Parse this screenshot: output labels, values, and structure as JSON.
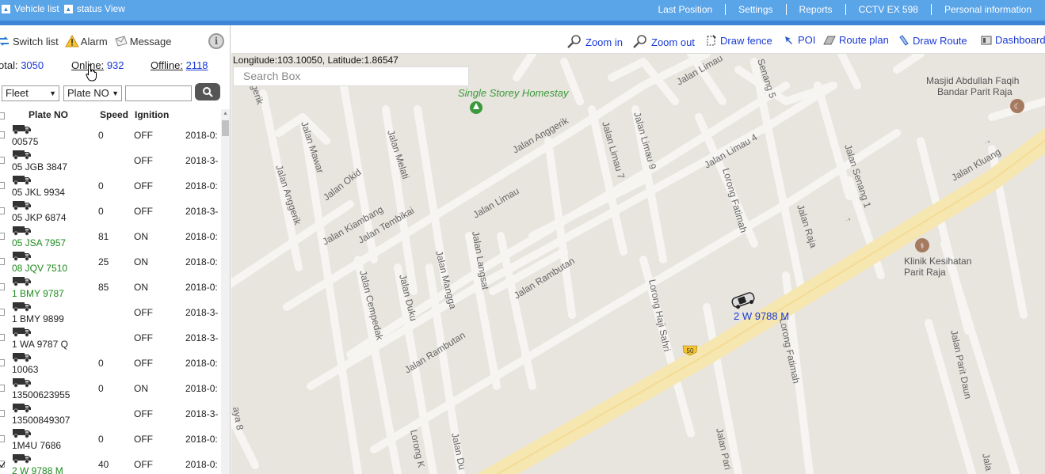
{
  "topbar": {
    "tabs": [
      {
        "label": "Vehicle list"
      },
      {
        "label": "status View"
      }
    ],
    "menus": [
      "Last Position",
      "Settings",
      "Reports",
      "CCTV EX 598",
      "Personal information"
    ]
  },
  "left_panel": {
    "tabs": [
      {
        "label": "Switch list",
        "icon": "switch-list-icon"
      },
      {
        "label": "Alarm",
        "icon": "warning-icon"
      },
      {
        "label": "Message",
        "icon": "message-icon"
      }
    ],
    "counts": {
      "total_label": "otal:",
      "total_value": "3050",
      "online_label": "Online:",
      "online_value": "932",
      "offline_label": "Offline:",
      "offline_value": "2118"
    },
    "filters": {
      "fleet_value": "Fleet",
      "plate_value": "Plate NO",
      "search_value": ""
    },
    "table": {
      "headers": {
        "plate": "Plate NO",
        "speed": "Speed",
        "ignition": "Ignition"
      },
      "rows": [
        {
          "plate": "00575",
          "speed": "0",
          "ignition": "OFF",
          "time": "2018-0:",
          "online": false,
          "checked": false
        },
        {
          "plate": "05 JGB 3847",
          "speed": "",
          "ignition": "OFF",
          "time": "2018-3-",
          "online": false,
          "checked": false
        },
        {
          "plate": "05 JKL 9934",
          "speed": "0",
          "ignition": "OFF",
          "time": "2018-0:",
          "online": false,
          "checked": false
        },
        {
          "plate": "05 JKP 6874",
          "speed": "0",
          "ignition": "OFF",
          "time": "2018-3-",
          "online": false,
          "checked": false
        },
        {
          "plate": "05 JSA 7957",
          "speed": "81",
          "ignition": "ON",
          "time": "2018-0:",
          "online": true,
          "checked": false
        },
        {
          "plate": "08 JQV 7510",
          "speed": "25",
          "ignition": "ON",
          "time": "2018-0:",
          "online": true,
          "checked": false
        },
        {
          "plate": "1 BMY 9787",
          "speed": "85",
          "ignition": "ON",
          "time": "2018-0:",
          "online": true,
          "checked": false
        },
        {
          "plate": "1 BMY 9899",
          "speed": "",
          "ignition": "OFF",
          "time": "2018-3-",
          "online": false,
          "checked": false
        },
        {
          "plate": "1 WA 9787 Q",
          "speed": "",
          "ignition": "OFF",
          "time": "2018-3-",
          "online": false,
          "checked": false
        },
        {
          "plate": "10063",
          "speed": "0",
          "ignition": "OFF",
          "time": "2018-0:",
          "online": false,
          "checked": false
        },
        {
          "plate": "13500623955",
          "speed": "0",
          "ignition": "ON",
          "time": "2018-0:",
          "online": false,
          "checked": false
        },
        {
          "plate": "13500849307",
          "speed": "",
          "ignition": "OFF",
          "time": "2018-3-",
          "online": false,
          "checked": false
        },
        {
          "plate": "1M4U 7686",
          "speed": "0",
          "ignition": "OFF",
          "time": "2018-0:",
          "online": false,
          "checked": false
        },
        {
          "plate": "2 W 9788 M",
          "speed": "40",
          "ignition": "OFF",
          "time": "2018-0:",
          "online": true,
          "checked": true
        }
      ]
    }
  },
  "map_toolbar": [
    {
      "label": "Zoom in",
      "icon": "zoom-in-icon"
    },
    {
      "label": "Zoom out",
      "icon": "zoom-out-icon"
    },
    {
      "label": "Draw fence",
      "icon": "draw-fence-icon"
    },
    {
      "label": "POI",
      "icon": "poi-icon"
    },
    {
      "label": "Route plan",
      "icon": "route-plan-icon"
    },
    {
      "label": "Draw Route",
      "icon": "draw-route-icon"
    },
    {
      "label": "Dashboard",
      "icon": "dashboard-icon"
    }
  ],
  "map": {
    "coordinates": "Longitude:103.10050, Latitude:1.86547",
    "search_placeholder": "Search Box",
    "vehicle_label": "2 W 9788 M",
    "road_shield": "50",
    "places": {
      "homestay": "Single Storey Homestay",
      "masjid_line1": "Masjid Abdullah Faqih",
      "masjid_line2": "Bandar Parit Raja",
      "klinik_line1": "Klinik Kesihatan",
      "klinik_line2": "Parit Raja"
    },
    "streets": {
      "limau_top": "Jalan Limau",
      "senang5": "Senang 5",
      "anggerik_top": "Jalan Anggerik",
      "gerik": "gerik",
      "mawar": "Jalan Mawar",
      "melati": "Jalan Melati",
      "okid": "Jalan Okid",
      "anggerik_left": "Jalan Anggerik",
      "kiambang": "Jalan Kiambang",
      "tembikai": "Jalan Tembikai",
      "limau7": "Jalan Limau 7",
      "limau9": "Jalan Limau 9",
      "limau4": "Jalan Limau 4",
      "limau": "Jalan Limau",
      "fatimah_top": "Lorong Fatimah",
      "senang1": "Jalan Senang 1",
      "kluang": "Jalan Kluang",
      "raja": "Jalan Raja",
      "langsat": "Jalan Langsat",
      "mangga": "Jalan Mangga",
      "duku": "Jalan Duku",
      "cempedak": "Jalan Cempedak",
      "rambutan_upper": "Jalan Rambutan",
      "rambutan_lower": "Jalan Rambutan",
      "haji_sahri": "Lorong Haji Sahri",
      "fatimah_bottom": "Lorong Fatimah",
      "parit_daun": "Jalan Parit Daun",
      "aya8": "aya 8",
      "lorong_k": "Lorong K",
      "jalan_du": "Jalan Du",
      "jalan_pari": "Jalan Pari",
      "jala": "Jala"
    }
  }
}
